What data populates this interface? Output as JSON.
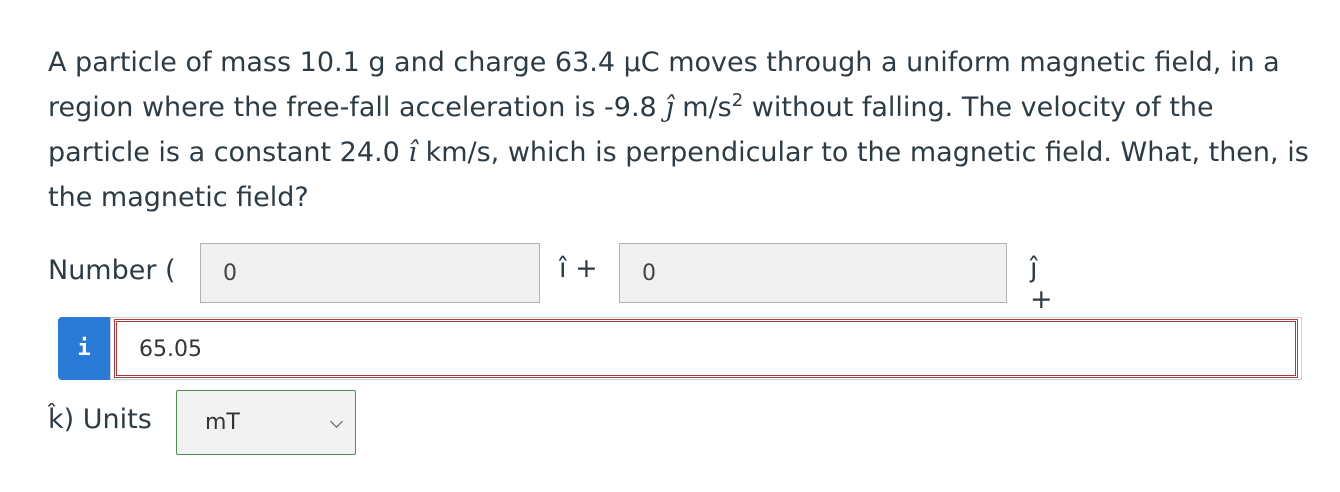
{
  "question": {
    "part1": "A particle of mass 10.1 g and charge 63.4 μC moves through a uniform magnetic field, in a region where the free-fall acceleration is -9.8 ",
    "j_hat": "ĵ",
    "part2": " m/s",
    "exp2": "2",
    "part3": " without falling. The velocity of the particle is a constant 24.0 ",
    "i_hat": "î",
    "part4": " km/s, which is perpendicular to the magnetic field. What, then, is the magnetic field?"
  },
  "answer": {
    "number_label": "Number (",
    "i_component_value": "0",
    "i_suffix": "î +",
    "j_component_value": "0",
    "j_suffix": "ĵ +",
    "info_icon": "i",
    "k_component_value": "65.05",
    "units_label": "k̂) Units",
    "units_selected": "mT"
  },
  "colors": {
    "info_tab": "#2a7bd8",
    "error_border": "#a83a3a",
    "select_border": "#4f8f4f"
  },
  "icons": {
    "info": "info-icon",
    "dropdown": "chevron-down-icon"
  }
}
